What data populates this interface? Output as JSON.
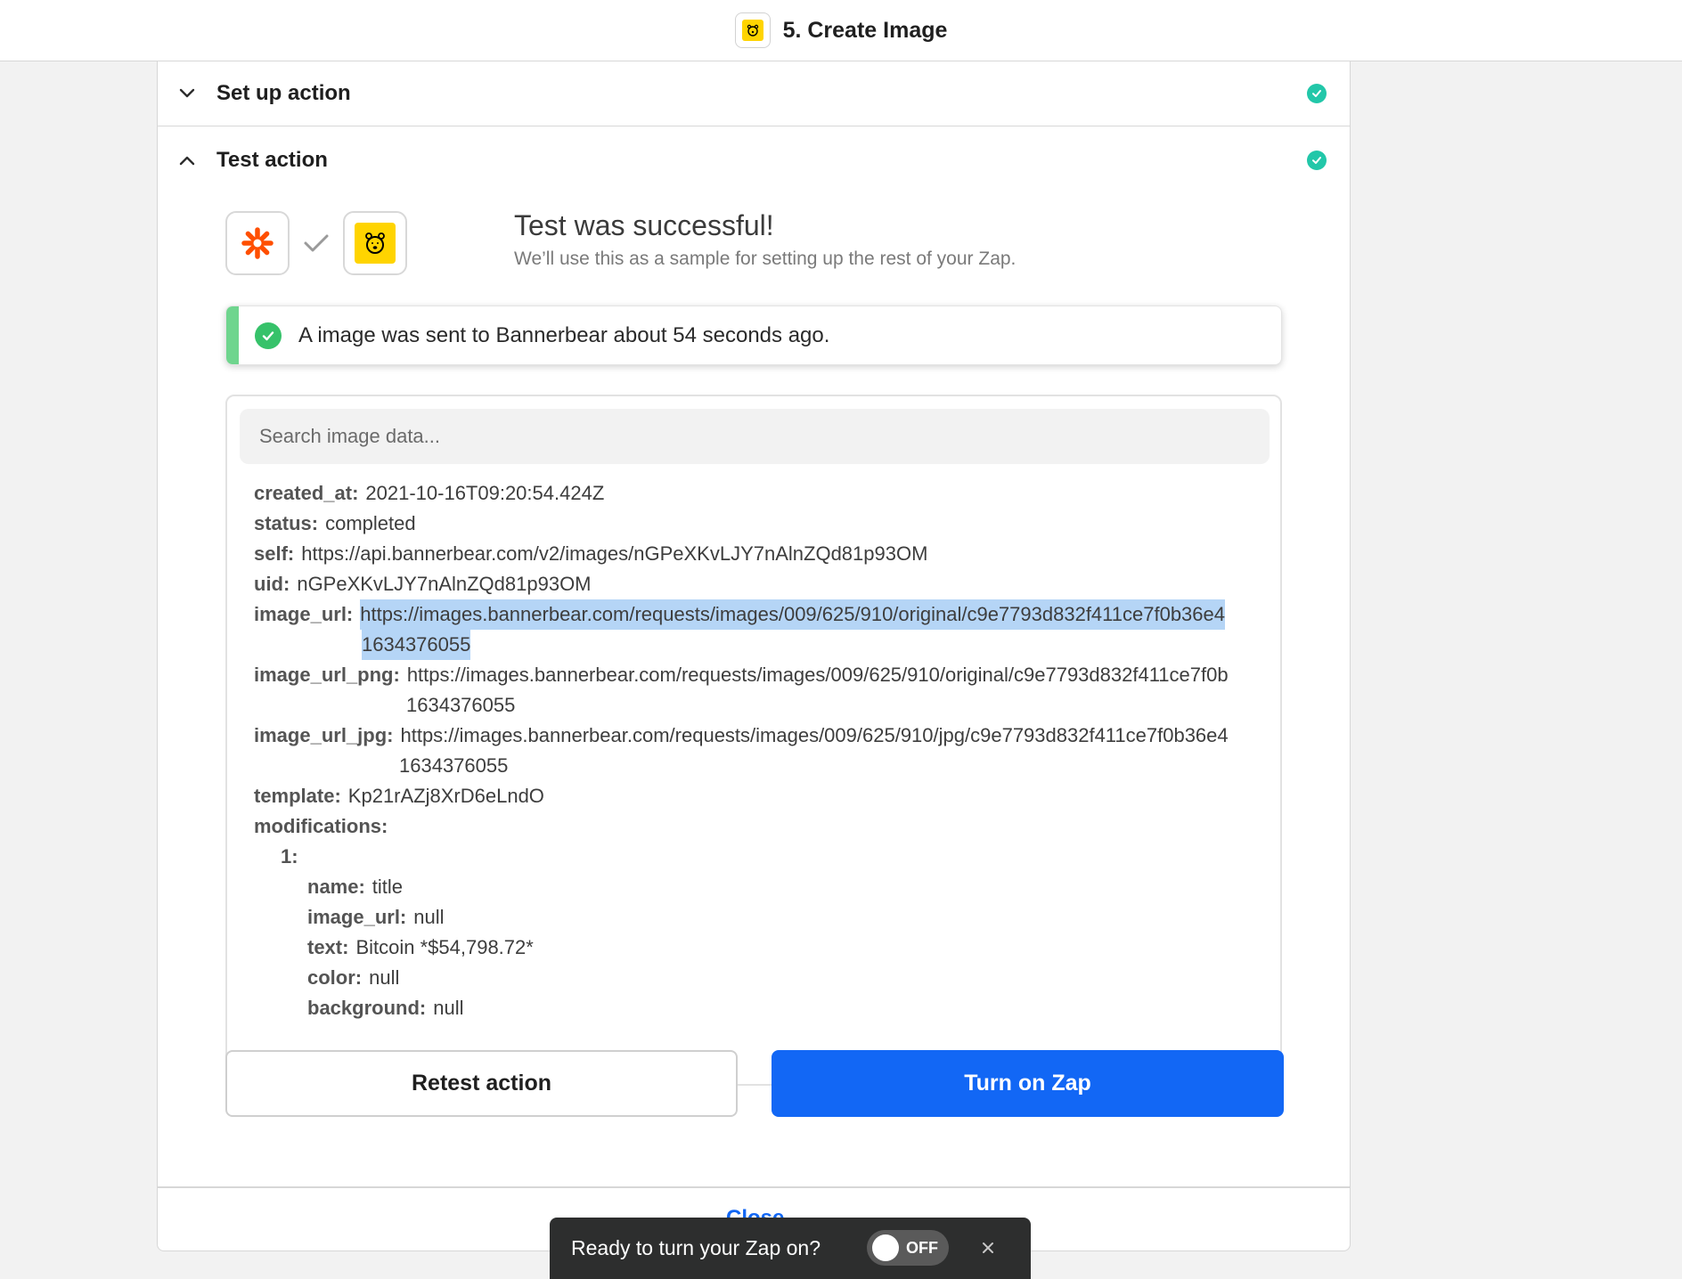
{
  "header": {
    "title": "5. Create Image",
    "app_icon": "bannerbear-icon"
  },
  "sections": {
    "setup": {
      "label": "Set up action",
      "status": "complete"
    },
    "test": {
      "label": "Test action",
      "status": "complete"
    }
  },
  "test_result": {
    "heading": "Test was successful!",
    "subheading": "We’ll use this as a sample for setting up the rest of your Zap.",
    "trigger_icon": "zapier-asterisk-icon",
    "action_icon": "bannerbear-icon"
  },
  "alert": {
    "message": "A image was sent to Bannerbear about 54 seconds ago."
  },
  "search": {
    "placeholder": "Search image data..."
  },
  "data": {
    "created_at": {
      "key": "created_at:",
      "value": "2021-10-16T09:20:54.424Z"
    },
    "status": {
      "key": "status:",
      "value": "completed"
    },
    "self": {
      "key": "self:",
      "value": "https://api.bannerbear.com/v2/images/nGPeXKvLJY7nAlnZQd81p93OM"
    },
    "uid": {
      "key": "uid:",
      "value": "nGPeXKvLJY7nAlnZQd81p93OM"
    },
    "image_url": {
      "key": "image_url:",
      "value": "https://images.bannerbear.com/requests/images/009/625/910/original/c9e7793d832f411ce7f0b36e4",
      "value_cont": "1634376055"
    },
    "image_url_png": {
      "key": "image_url_png:",
      "value": "https://images.bannerbear.com/requests/images/009/625/910/original/c9e7793d832f411ce7f0b",
      "value_cont": "1634376055"
    },
    "image_url_jpg": {
      "key": "image_url_jpg:",
      "value": "https://images.bannerbear.com/requests/images/009/625/910/jpg/c9e7793d832f411ce7f0b36e4",
      "value_cont": "1634376055"
    },
    "template": {
      "key": "template:",
      "value": "Kp21rAZj8XrD6eLndO"
    },
    "modifications": {
      "key": "modifications:"
    },
    "mod_index": {
      "key": "1:"
    },
    "mod_name": {
      "key": "name:",
      "value": "title"
    },
    "mod_image_url": {
      "key": "image_url:",
      "value": "null"
    },
    "mod_text": {
      "key": "text:",
      "value": "Bitcoin *$54,798.72*"
    },
    "mod_color": {
      "key": "color:",
      "value": "null"
    },
    "mod_background": {
      "key": "background:",
      "value": "null"
    }
  },
  "buttons": {
    "retest": "Retest action",
    "turn_on": "Turn on Zap"
  },
  "footer": {
    "close": "Close"
  },
  "toast": {
    "message": "Ready to turn your Zap on?",
    "toggle_state": "OFF"
  },
  "colors": {
    "primary": "#1267f5",
    "success": "#36c26a",
    "check": "#22c7a9",
    "brand_yellow": "#ffd400",
    "zapier_orange": "#ff4f00",
    "selection": "#b5d5f6"
  }
}
